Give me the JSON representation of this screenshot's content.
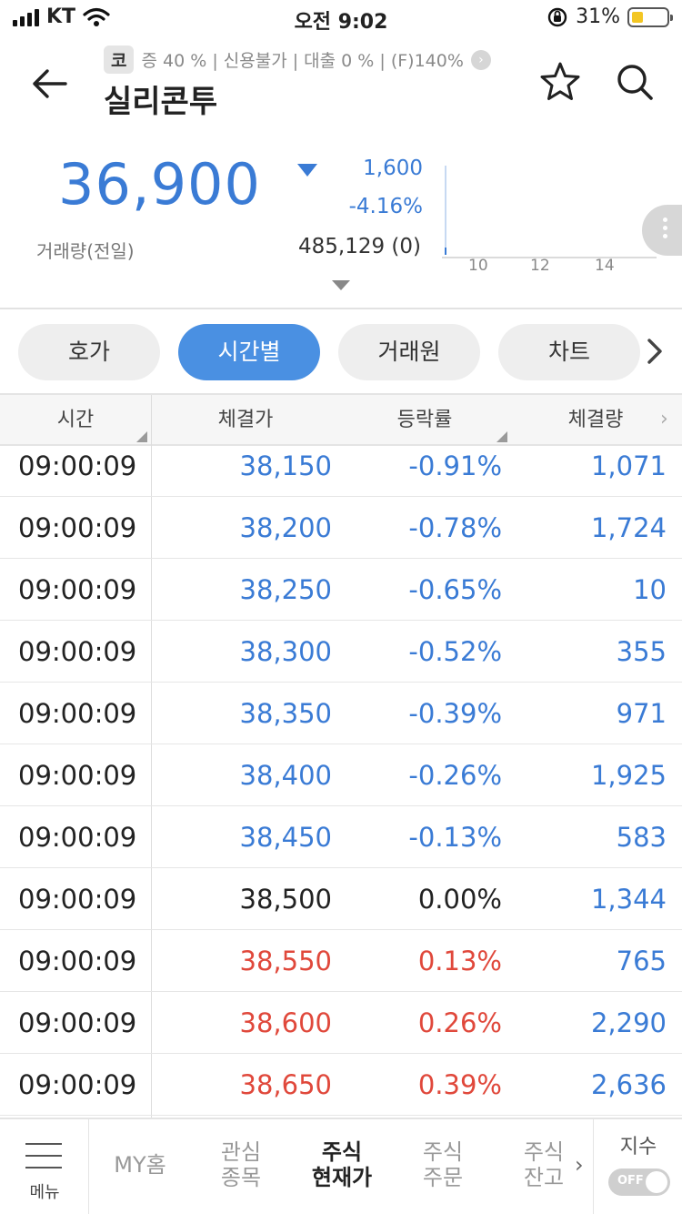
{
  "status_bar": {
    "carrier": "KT",
    "time": "오전 9:02",
    "battery_pct": "31%",
    "battery_level": 0.31
  },
  "header": {
    "badge": "코",
    "sub_info": "증 40 % | 신용불가 | 대출 0 % | (F)140%",
    "stock_name": "실리콘투",
    "icons": [
      "back-arrow-icon",
      "star-icon",
      "search-icon"
    ]
  },
  "price_panel": {
    "price": "36,900",
    "change": "1,600",
    "change_pct": "-4.16%",
    "volume_label": "거래량(전일)",
    "volume_value": "485,129 (0)",
    "mini_chart_ticks": [
      "10",
      "12",
      "14"
    ],
    "colors": {
      "down": "#3a7bd5",
      "up": "#e0483b"
    }
  },
  "tabs": [
    {
      "label": "호가",
      "active": false
    },
    {
      "label": "시간별",
      "active": true
    },
    {
      "label": "거래원",
      "active": false
    },
    {
      "label": "차트",
      "active": false
    }
  ],
  "table": {
    "headers": [
      "시간",
      "체결가",
      "등락률",
      "체결량"
    ],
    "rows": [
      {
        "time": "09:00:09",
        "price": "38,150",
        "pct": "-0.91%",
        "vol": "1,071",
        "dir": "blue"
      },
      {
        "time": "09:00:09",
        "price": "38,200",
        "pct": "-0.78%",
        "vol": "1,724",
        "dir": "blue"
      },
      {
        "time": "09:00:09",
        "price": "38,250",
        "pct": "-0.65%",
        "vol": "10",
        "dir": "blue"
      },
      {
        "time": "09:00:09",
        "price": "38,300",
        "pct": "-0.52%",
        "vol": "355",
        "dir": "blue"
      },
      {
        "time": "09:00:09",
        "price": "38,350",
        "pct": "-0.39%",
        "vol": "971",
        "dir": "blue"
      },
      {
        "time": "09:00:09",
        "price": "38,400",
        "pct": "-0.26%",
        "vol": "1,925",
        "dir": "blue"
      },
      {
        "time": "09:00:09",
        "price": "38,450",
        "pct": "-0.13%",
        "vol": "583",
        "dir": "blue"
      },
      {
        "time": "09:00:09",
        "price": "38,500",
        "pct": "0.00%",
        "vol": "1,344",
        "dir": "black"
      },
      {
        "time": "09:00:09",
        "price": "38,550",
        "pct": "0.13%",
        "vol": "765",
        "dir": "red"
      },
      {
        "time": "09:00:09",
        "price": "38,600",
        "pct": "0.26%",
        "vol": "2,290",
        "dir": "red"
      },
      {
        "time": "09:00:09",
        "price": "38,650",
        "pct": "0.39%",
        "vol": "2,636",
        "dir": "red"
      }
    ]
  },
  "bottom_nav": {
    "menu_label": "메뉴",
    "items": [
      {
        "line1": "MY홈",
        "line2": "",
        "active": false
      },
      {
        "line1": "관심",
        "line2": "종목",
        "active": false
      },
      {
        "line1": "주식",
        "line2": "현재가",
        "active": true
      },
      {
        "line1": "주식",
        "line2": "주문",
        "active": false
      },
      {
        "line1": "주식",
        "line2": "잔고",
        "active": false
      }
    ],
    "index_label": "지수",
    "toggle_text": "OFF"
  }
}
